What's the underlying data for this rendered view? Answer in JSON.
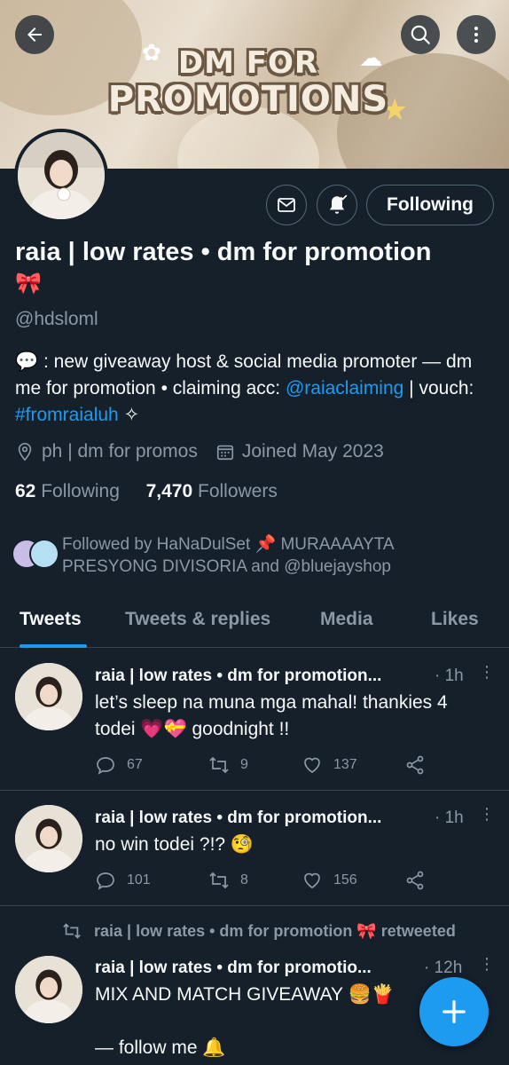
{
  "banner": {
    "line1": "DM FOR",
    "line2": "PROMOTIONS"
  },
  "profile": {
    "name": "raia | low rates • dm for promotion",
    "name_emoji": "🎀",
    "handle": "@hdsloml",
    "bio_prefix": "💬 : new giveaway host & social media promoter — dm me for promotion • claiming acc: ",
    "bio_link1": "@raiaclaiming",
    "bio_mid": " | vouch: ",
    "bio_link2": "#fromraialuh",
    "bio_suffix": " ✧",
    "location": "ph | dm for promos",
    "joined": "Joined May 2023",
    "following_count": "62",
    "following_label": " Following",
    "followers_count": "7,470",
    "followers_label": " Followers",
    "followed_by": "Followed by HaNaDulSet 📌 MURAAAAYTA PRESYONG DIVISORIA and @bluejayshop"
  },
  "buttons": {
    "following": "Following"
  },
  "tabs": [
    "Tweets",
    "Tweets & replies",
    "Media",
    "Likes"
  ],
  "tweets": [
    {
      "name": "raia | low rates • dm for promotion...",
      "time": "· 1h",
      "text": "let’s sleep na muna mga mahal! thankies 4 todei 💗💝 goodnight !!",
      "replies": "67",
      "retweets": "9",
      "likes": "137"
    },
    {
      "name": "raia | low rates • dm for promotion...",
      "time": "· 1h",
      "text": "no win todei ?!? 🧐",
      "replies": "101",
      "retweets": "8",
      "likes": "156"
    },
    {
      "retweet_label": "raia | low rates • dm for promotion 🎀 retweeted",
      "name": "raia | low rates • dm for promotio...",
      "time": "· 12h",
      "text_line1": "MIX AND MATCH GIVEAWAY 🍔🍟",
      "text_line2": "— follow me 🔔"
    }
  ],
  "colors": {
    "background": "#15202b",
    "accent": "#1d9bf0",
    "secondary_text": "#8b98a5",
    "border": "#38444d"
  }
}
